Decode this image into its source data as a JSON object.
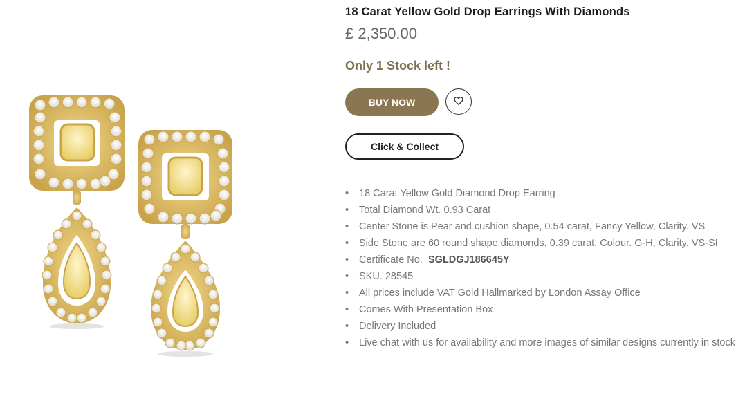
{
  "product": {
    "title": "18 Carat Yellow Gold Drop Earrings With Diamonds",
    "price": "£ 2,350.00",
    "stock_text": "Only 1 Stock left !",
    "buy_label": "BUY NOW",
    "collect_label": "Click & Collect",
    "wishlist_icon": "heart-icon",
    "image_alt": "Yellow gold drop earrings with diamonds"
  },
  "features": [
    "18 Carat Yellow Gold Diamond Drop Earring",
    "Total Diamond Wt. 0.93 Carat",
    "Center Stone is Pear and cushion shape, 0.54 carat, Fancy Yellow, Clarity. VS",
    "Side Stone are 60 round shape diamonds, 0.39 carat, Colour. G-H, Clarity. VS-SI",
    "Certificate No.",
    "SKU. 28545",
    "All prices include VAT Gold Hallmarked by London Assay Office",
    "Comes With Presentation Box",
    "Delivery Included",
    "Live chat with us for availability and more images of similar designs currently in stock"
  ],
  "certificate_number": "SGLDGJ186645Y",
  "colors": {
    "accent": "#8a7751",
    "stock_text": "#7d6f4f",
    "body_text": "#777777"
  }
}
